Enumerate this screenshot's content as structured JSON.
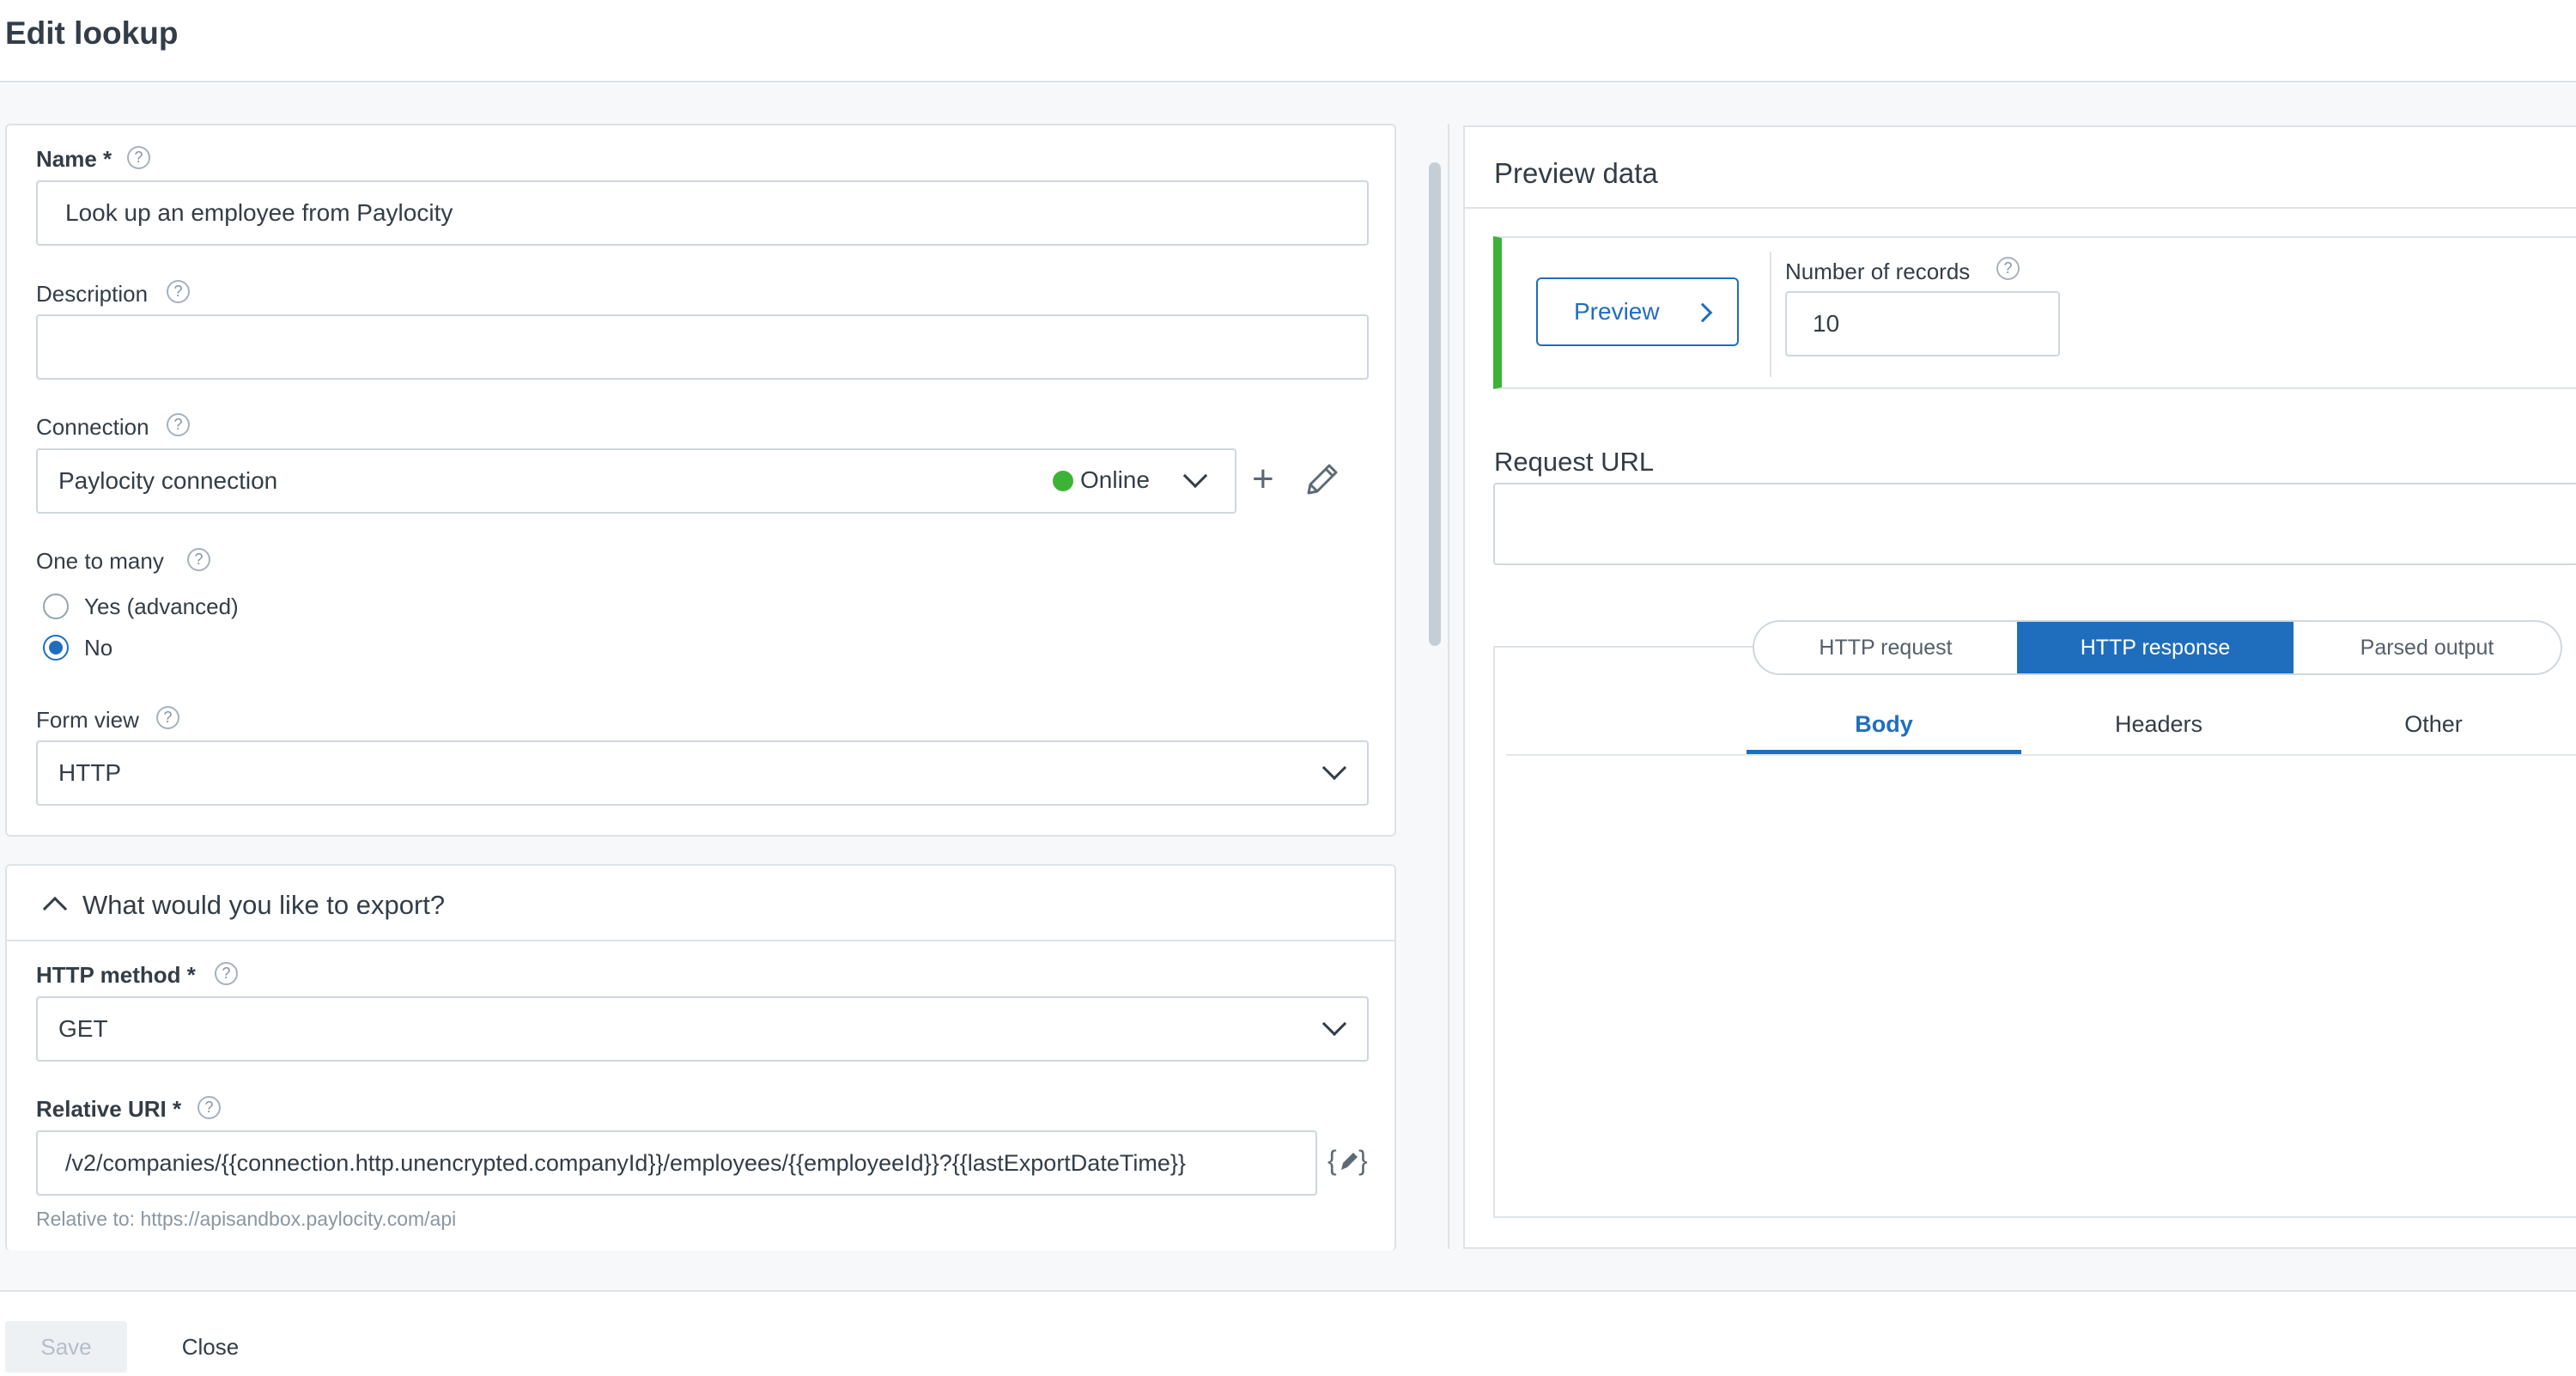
{
  "header": {
    "title": "Edit lookup"
  },
  "form": {
    "name": {
      "label": "Name *",
      "value": "Look up an employee from Paylocity"
    },
    "description": {
      "label": "Description",
      "value": ""
    },
    "connection": {
      "label": "Connection",
      "value": "Paylocity connection",
      "status": "Online",
      "status_color": "#3db336"
    },
    "one_to_many": {
      "label": "One to many",
      "options": [
        "Yes (advanced)",
        "No"
      ],
      "selected": "No"
    },
    "form_view": {
      "label": "Form view",
      "value": "HTTP"
    },
    "export_section": {
      "title": "What would you like to export?"
    },
    "http_method": {
      "label": "HTTP method *",
      "value": "GET"
    },
    "relative_uri": {
      "label": "Relative URI *",
      "value": "/v2/companies/{{connection.http.unencrypted.companyId}}/employees/{{employeeId}}?{{lastExportDateTime}}",
      "hint": "Relative to: https://apisandbox.paylocity.com/api"
    },
    "help_glyph": "?"
  },
  "preview": {
    "title": "Preview data",
    "button_label": "Preview",
    "records_label": "Number of records",
    "records_value": "10",
    "request_url_label": "Request URL",
    "request_url_value": "",
    "segment_tabs": [
      "HTTP request",
      "HTTP response",
      "Parsed output"
    ],
    "active_segment": "HTTP response",
    "sub_tabs": [
      "Body",
      "Headers",
      "Other"
    ],
    "active_sub_tab": "Body"
  },
  "footer": {
    "save_label": "Save",
    "close_label": "Close"
  },
  "colors": {
    "accent": "#1f6ebe",
    "online": "#3db336",
    "border": "#dde3e8"
  },
  "icons": [
    "help-icon",
    "chevron-down-icon",
    "chevron-up-icon",
    "chevron-right-icon",
    "plus-icon",
    "pencil-icon",
    "handlebars-edit-icon"
  ]
}
